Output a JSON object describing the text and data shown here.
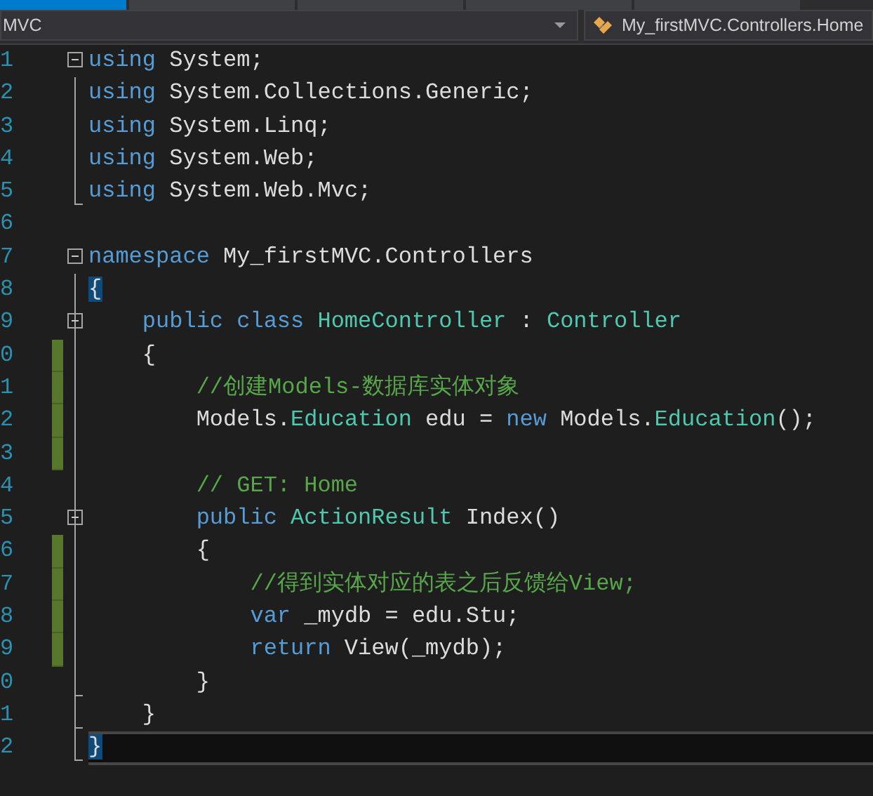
{
  "tabs": [
    {
      "selected": true
    },
    {
      "selected": false
    },
    {
      "selected": false
    },
    {
      "selected": false
    },
    {
      "selected": false
    }
  ],
  "nav_bar": {
    "project": "MVC",
    "member": "My_firstMVC.Controllers.Home"
  },
  "lines": [
    {
      "number": "1",
      "collapsible": true,
      "fold_end": false,
      "changed": false,
      "current": false,
      "segments": [
        {
          "kind": "keyword",
          "text": "using"
        },
        {
          "kind": "plain",
          "text": " System;"
        }
      ]
    },
    {
      "number": "2",
      "collapsible": false,
      "fold_end": false,
      "changed": false,
      "current": false,
      "segments": [
        {
          "kind": "keyword",
          "text": "using"
        },
        {
          "kind": "plain",
          "text": " System.Collections.Generic;"
        }
      ]
    },
    {
      "number": "3",
      "collapsible": false,
      "fold_end": false,
      "changed": false,
      "current": false,
      "segments": [
        {
          "kind": "keyword",
          "text": "using"
        },
        {
          "kind": "plain",
          "text": " System.Linq;"
        }
      ]
    },
    {
      "number": "4",
      "collapsible": false,
      "fold_end": false,
      "changed": false,
      "current": false,
      "segments": [
        {
          "kind": "keyword",
          "text": "using"
        },
        {
          "kind": "plain",
          "text": " System.Web;"
        }
      ]
    },
    {
      "number": "5",
      "collapsible": false,
      "fold_end": true,
      "changed": false,
      "current": false,
      "segments": [
        {
          "kind": "keyword",
          "text": "using"
        },
        {
          "kind": "plain",
          "text": " System.Web.Mvc;"
        }
      ]
    },
    {
      "number": "6",
      "collapsible": false,
      "fold_end": false,
      "changed": false,
      "current": false
    },
    {
      "number": "7",
      "collapsible": true,
      "fold_end": false,
      "changed": false,
      "current": false,
      "segments": [
        {
          "kind": "keyword",
          "text": "namespace"
        },
        {
          "kind": "plain",
          "text": " My_firstMVC.Controllers"
        }
      ]
    },
    {
      "number": "8",
      "collapsible": false,
      "fold_end": false,
      "changed": false,
      "current": false,
      "segments": [
        {
          "kind": "brace-match",
          "text": "{"
        }
      ]
    },
    {
      "number": "9",
      "collapsible": true,
      "fold_end": false,
      "changed": false,
      "current": false,
      "segments": [
        {
          "kind": "keyword",
          "text": "    public class"
        },
        {
          "kind": "type",
          "text": " HomeController"
        },
        {
          "kind": "plain",
          "text": " :"
        },
        {
          "kind": "type",
          "text": " Controller"
        }
      ]
    },
    {
      "number": "0",
      "collapsible": false,
      "fold_end": false,
      "changed": true,
      "current": false,
      "segments": [
        {
          "kind": "plain",
          "text": "    {"
        }
      ]
    },
    {
      "number": "1",
      "collapsible": false,
      "fold_end": false,
      "changed": true,
      "current": false,
      "segments": [
        {
          "kind": "comment",
          "text": "        //创建Models-数据库实体对象"
        }
      ]
    },
    {
      "number": "2",
      "collapsible": false,
      "fold_end": false,
      "changed": true,
      "current": false,
      "segments": [
        {
          "kind": "plain",
          "text": "        Models."
        },
        {
          "kind": "type",
          "text": "Education"
        },
        {
          "kind": "plain",
          "text": " edu ="
        },
        {
          "kind": "keyword",
          "text": " new"
        },
        {
          "kind": "plain",
          "text": " Models."
        },
        {
          "kind": "type",
          "text": "Education"
        },
        {
          "kind": "plain",
          "text": "();"
        }
      ]
    },
    {
      "number": "3",
      "collapsible": false,
      "fold_end": false,
      "changed": true,
      "current": false
    },
    {
      "number": "4",
      "collapsible": false,
      "fold_end": false,
      "changed": false,
      "current": false,
      "segments": [
        {
          "kind": "comment",
          "text": "        // GET: Home"
        }
      ]
    },
    {
      "number": "5",
      "collapsible": true,
      "fold_end": false,
      "changed": false,
      "current": false,
      "segments": [
        {
          "kind": "keyword",
          "text": "        public"
        },
        {
          "kind": "type",
          "text": " ActionResult"
        },
        {
          "kind": "plain",
          "text": " Index()"
        }
      ]
    },
    {
      "number": "6",
      "collapsible": false,
      "fold_end": false,
      "changed": true,
      "current": false,
      "segments": [
        {
          "kind": "plain",
          "text": "        {"
        }
      ]
    },
    {
      "number": "7",
      "collapsible": false,
      "fold_end": false,
      "changed": true,
      "current": false,
      "segments": [
        {
          "kind": "comment",
          "text": "            //得到实体对应的表之后反馈给View;"
        }
      ]
    },
    {
      "number": "8",
      "collapsible": false,
      "fold_end": false,
      "changed": true,
      "current": false,
      "segments": [
        {
          "kind": "keyword",
          "text": "            var"
        },
        {
          "kind": "plain",
          "text": " _mydb = edu.Stu;"
        }
      ]
    },
    {
      "number": "9",
      "collapsible": false,
      "fold_end": false,
      "changed": true,
      "current": false,
      "segments": [
        {
          "kind": "keyword",
          "text": "            return"
        },
        {
          "kind": "plain",
          "text": " View(_mydb);"
        }
      ]
    },
    {
      "number": "0",
      "collapsible": false,
      "fold_end": true,
      "changed": false,
      "current": false,
      "segments": [
        {
          "kind": "plain",
          "text": "        }"
        }
      ]
    },
    {
      "number": "1",
      "collapsible": false,
      "fold_end": true,
      "changed": false,
      "current": false,
      "segments": [
        {
          "kind": "plain",
          "text": "    }"
        }
      ]
    },
    {
      "number": "2",
      "collapsible": false,
      "fold_end": true,
      "changed": false,
      "current": true,
      "segments": [
        {
          "kind": "brace-match",
          "text": "}"
        }
      ]
    }
  ]
}
